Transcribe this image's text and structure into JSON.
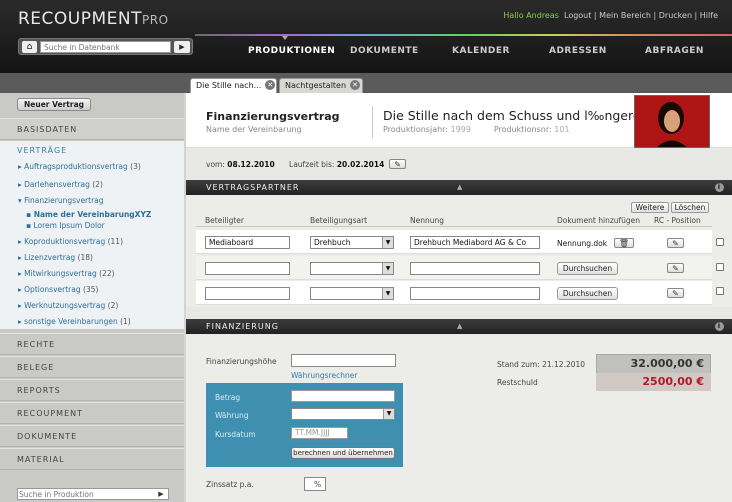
{
  "app": {
    "name": "RECOUPMENT",
    "suffix": "PRO"
  },
  "user_links": {
    "greeting": "Hallo Andreas",
    "rest": "Logout | Mein Bereich | Drucken | Hilfe"
  },
  "top_search": {
    "placeholder": "Suche in Datenbank"
  },
  "nav": {
    "items": [
      "PRODUKTIONEN",
      "DOKUMENTE",
      "KALENDER",
      "ADRESSEN",
      "ABFRAGEN"
    ],
    "active": "PRODUKTIONEN"
  },
  "tabs": [
    {
      "label": "Die Stille nach..."
    },
    {
      "label": "Nachtgestalten"
    }
  ],
  "sidebar": {
    "new_button": "Neuer Vertrag",
    "basisdaten": "BASISDATEN",
    "vertraege_title": "VERTRÄGE",
    "vertraege": [
      {
        "label": "Auftragsproduktionsvertrag",
        "count": "(3)"
      },
      {
        "label": "Darlehensvertrag",
        "count": "(2)"
      },
      {
        "label": "Finanzierungsvertrag",
        "count": ""
      },
      {
        "label": "Koproduktionsvertrag",
        "count": "(11)"
      },
      {
        "label": "Lizenzvertrag",
        "count": "(18)"
      },
      {
        "label": "Mitwirkungsvertrag",
        "count": "(22)"
      },
      {
        "label": "Optionsvertrag",
        "count": "(35)"
      },
      {
        "label": "Werknutzungsvertrag",
        "count": "(2)"
      },
      {
        "label": "sonstige Vereinbarungen",
        "count": "(1)"
      }
    ],
    "sub_items": [
      "Name der VereinbarungXYZ",
      "Lorem Ipsum Dolor"
    ],
    "sections": [
      "RECHTE",
      "BELEGE",
      "REPORTS",
      "RECOUPMENT",
      "DOKUMENTE",
      "MATERIAL"
    ],
    "search_placeholder": "Suche in Produktion"
  },
  "header": {
    "contract_type": "Finanzierungsvertrag",
    "contract_name": "Name der Vereinbarung",
    "title": "Die Stille nach dem Schuss und l‰ngerer…",
    "year_label": "Produktionsjahr:",
    "year": "1999",
    "nr_label": "Produktionsnr:",
    "nr": "101"
  },
  "dates": {
    "from_label": "vom:",
    "from": "08.12.2010",
    "until_label": "Laufzeit bis:",
    "until": "20.02.2014"
  },
  "vertragspartner": {
    "title": "VERTRAGSPARTNER",
    "btn_more": "Weitere",
    "btn_delete": "Löschen",
    "columns": [
      "Beteiligter",
      "Beteiligungsart",
      "Nennung",
      "Dokument hinzufügen",
      "RC - Position"
    ],
    "rows": [
      {
        "beteiligter": "Mediaboard",
        "art": "Drehbuch",
        "nennung": "Drehbuch Mediabord AG & Co",
        "doc": "Nennung.dok"
      },
      {
        "beteiligter": "",
        "art": "",
        "nennung": "",
        "doc_button": "Durchsuchen"
      },
      {
        "beteiligter": "",
        "art": "",
        "nennung": "",
        "doc_button": "Durchsuchen"
      }
    ]
  },
  "finanzierung": {
    "title": "FINANZIERUNG",
    "hoehe_label": "Finanzierungshöhe",
    "rechner_link": "Währungsrechner",
    "betrag_label": "Betrag",
    "waehrung_label": "Währung",
    "kursdatum_label": "Kursdatum",
    "kursdatum_placeholder": "TT.MM.JJJJ",
    "calc_button": "berechnen und übernehmen",
    "stand_label": "Stand zum:",
    "stand_date": "21.12.2010",
    "restschuld_label": "Restschuld",
    "amount": "32.000,00 €",
    "restschuld": "2500,00 €",
    "zins_label": "Zinssatz p.a.",
    "zins_unit": "%"
  },
  "colors": {
    "accent_blue": "#3e8fb0",
    "link_blue": "#2f7fa8",
    "alert_red": "#b3182a",
    "user_green": "#8dc84a"
  }
}
